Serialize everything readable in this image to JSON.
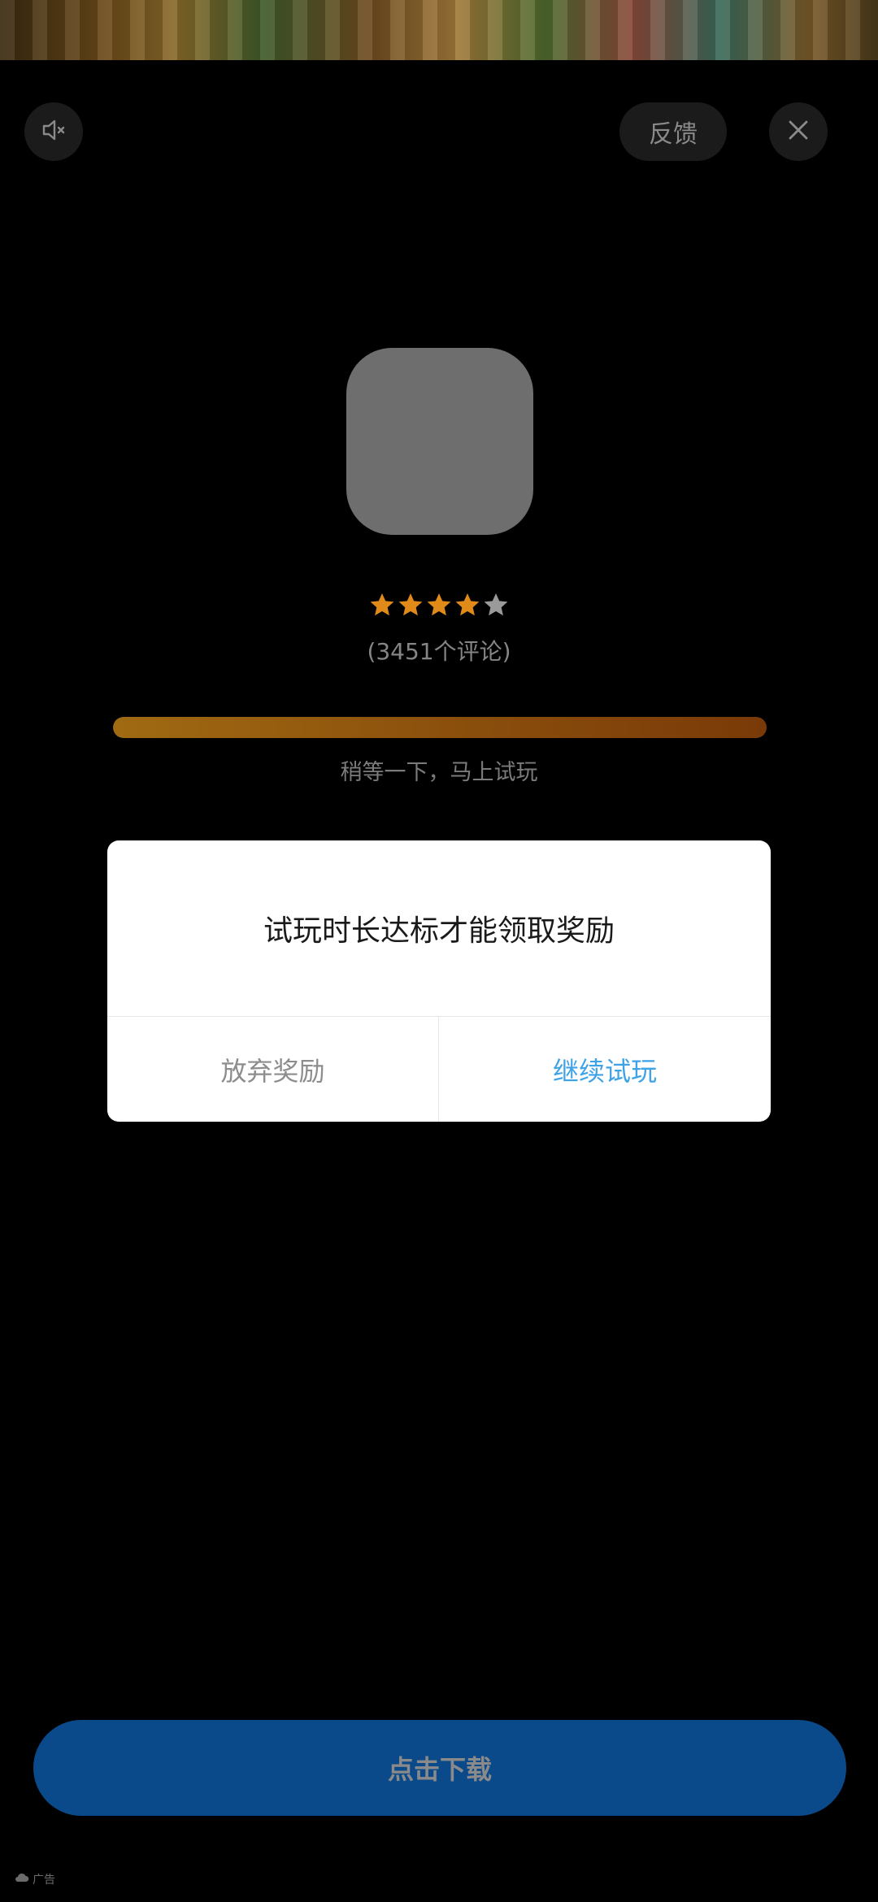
{
  "controls": {
    "feedback_label": "反馈"
  },
  "app": {
    "rating_stars": 4,
    "rating_max": 5,
    "reviews_text": "(3451个评论)"
  },
  "progress": {
    "fraction": 1.0,
    "text": "稍等一下，马上试玩"
  },
  "dialog": {
    "message": "试玩时长达标才能领取奖励",
    "cancel_label": "放弃奖励",
    "confirm_label": "继续试玩"
  },
  "cta": {
    "label": "点击下载"
  },
  "ad_label": "广告",
  "colors": {
    "star_filled": "#e08a1a",
    "star_empty": "#9a9a9a",
    "confirm_text": "#3ea2e6",
    "cta_bg": "#0b4a8a"
  },
  "icons": [
    "mute-icon",
    "close-icon",
    "star-icon",
    "ad-cloud-icon"
  ]
}
